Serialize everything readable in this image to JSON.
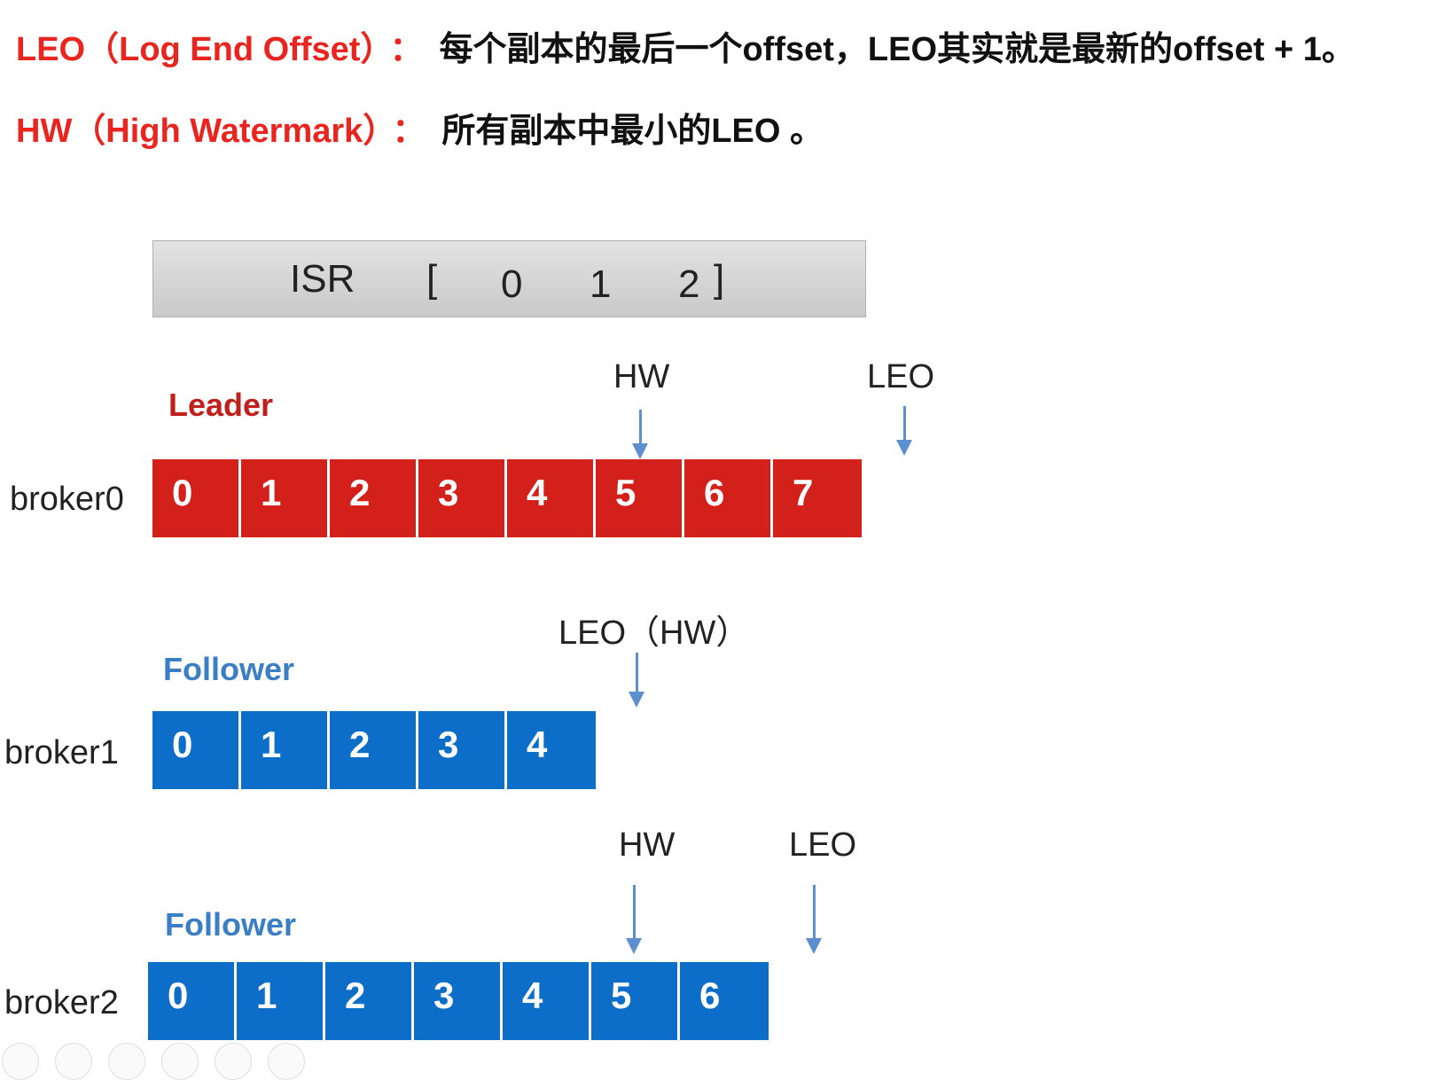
{
  "definitions": {
    "leo": {
      "term": "LEO（Log End Offset）",
      "colon": "：",
      "desc": "每个副本的最后一个offset，LEO其实就是最新的offset + 1。"
    },
    "hw": {
      "term": "HW（High Watermark）",
      "colon": "：",
      "desc": "所有副本中最小的LEO 。"
    }
  },
  "isr": {
    "label": "ISR",
    "open": "[",
    "ids": [
      "0",
      "1",
      "2"
    ],
    "close": "]"
  },
  "brokers": [
    {
      "name": "broker0",
      "role": "Leader",
      "color": "#d4201b",
      "cells": [
        "0",
        "1",
        "2",
        "3",
        "4",
        "5",
        "6",
        "7"
      ],
      "pointers": [
        {
          "label": "HW",
          "offset": 5
        },
        {
          "label": "LEO",
          "offset": 8
        }
      ]
    },
    {
      "name": "broker1",
      "role": "Follower",
      "color": "#0d6ec9",
      "cells": [
        "0",
        "1",
        "2",
        "3",
        "4"
      ],
      "pointers": [
        {
          "label": "LEO（HW）",
          "offset": 5
        }
      ]
    },
    {
      "name": "broker2",
      "role": "Follower",
      "color": "#0d6ec9",
      "cells": [
        "0",
        "1",
        "2",
        "3",
        "4",
        "5",
        "6"
      ],
      "pointers": [
        {
          "label": "HW",
          "offset": 5
        },
        {
          "label": "LEO",
          "offset": 7
        }
      ]
    }
  ],
  "colors": {
    "term": "#e8251e",
    "leader": "#c0201c",
    "follower": "#3a7ec6",
    "arrow": "#5b8fd0"
  },
  "toolbar_icons": [
    "prev-icon",
    "next-icon",
    "pen-icon",
    "slides-icon",
    "zoom-icon",
    "more-icon"
  ]
}
